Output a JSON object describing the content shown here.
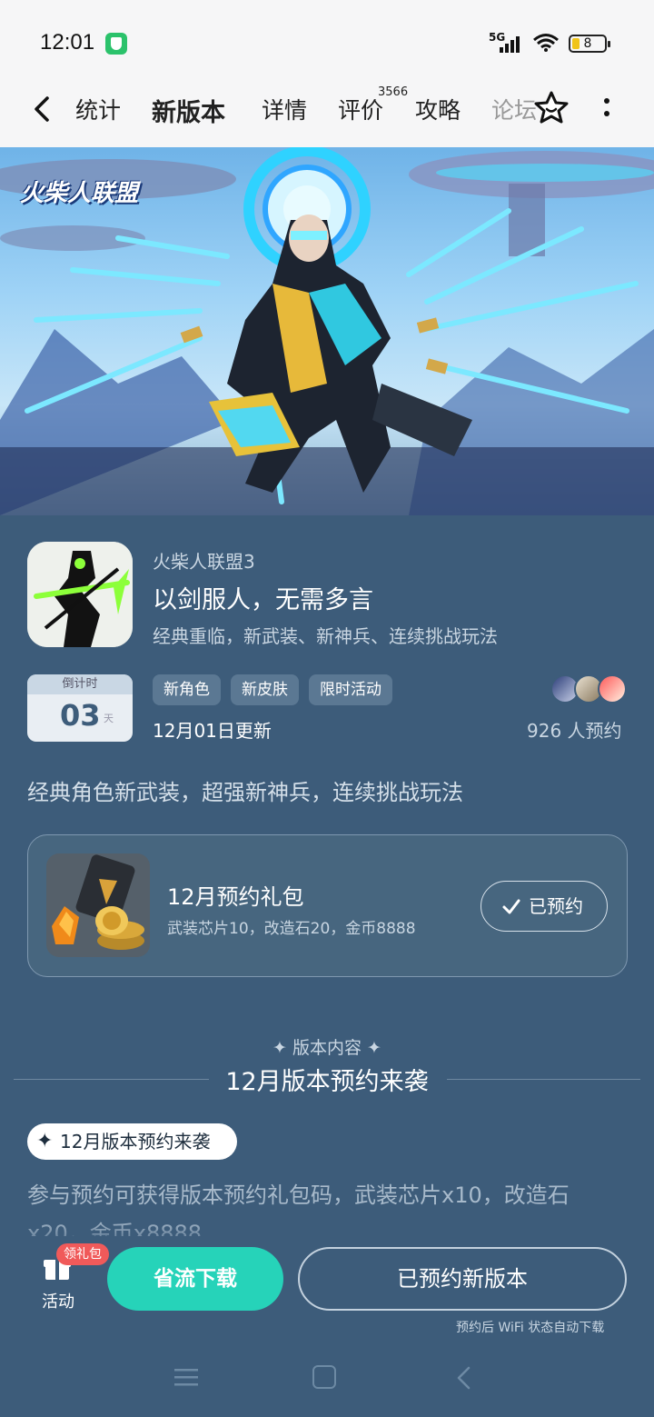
{
  "status_bar": {
    "time": "12:01",
    "network": "5G",
    "battery": "8"
  },
  "nav": {
    "tabs": [
      {
        "label": "统计"
      },
      {
        "label": "新版本"
      },
      {
        "label": "详情"
      },
      {
        "label": "评价"
      },
      {
        "label": "攻略"
      },
      {
        "label": "论坛"
      }
    ],
    "review_count": "3566",
    "active_tab": "新版本"
  },
  "banner": {
    "logo_text": "火柴人联盟"
  },
  "game": {
    "name": "火柴人联盟3",
    "slogan": "以剑服人，无需多言",
    "description": "经典重临，新武装、新神兵、连续挑战玩法"
  },
  "countdown": {
    "label": "倒计时",
    "value": "03",
    "unit": "天"
  },
  "tags": [
    "新角色",
    "新皮肤",
    "限时活动"
  ],
  "update_date": "12月01日更新",
  "reservations": "926 人预约",
  "tagline": "经典角色新武装，超强新神兵，连续挑战玩法",
  "gift": {
    "title": "12月预约礼包",
    "items": "武装芯片10，改造石20，金币8888",
    "button_label": "已预约"
  },
  "section": {
    "kicker": "✦ 版本内容 ✦",
    "title": "12月版本预约来袭",
    "chip_label": "12月版本预约来袭",
    "body": "参与预约可获得版本预约礼包码，武装芯片x10，改造石x20，金币x8888"
  },
  "bottom": {
    "activity_badge": "领礼包",
    "activity_label": "活动",
    "download_label": "省流下载",
    "reserve_label": "已预约新版本",
    "reserve_note": "预约后 WiFi 状态自动下载"
  },
  "colors": {
    "accent": "#26d3b9",
    "background": "#3d5c7a",
    "badge": "#f05a5a"
  }
}
